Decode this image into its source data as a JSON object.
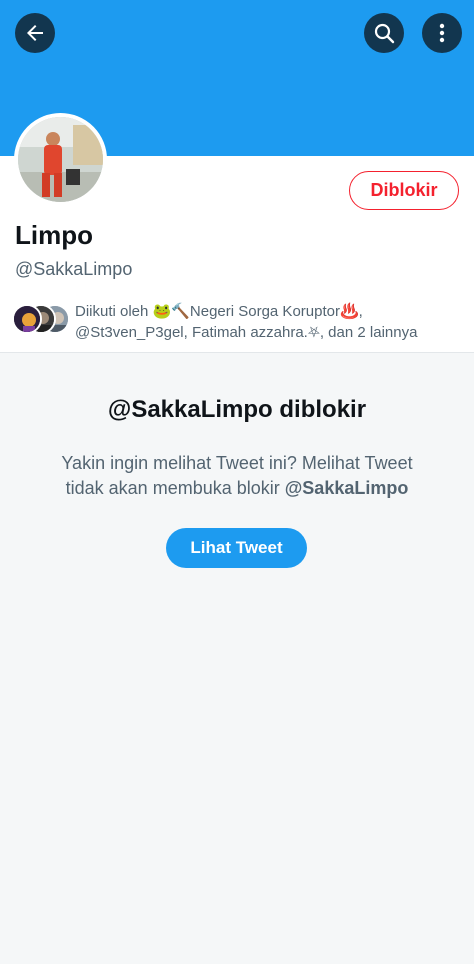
{
  "header": {
    "back_icon": "arrow-left-icon",
    "search_icon": "search-icon",
    "more_icon": "more-vertical-icon"
  },
  "profile": {
    "display_name": "Limpo",
    "handle": "@SakkaLimpo",
    "block_button_label": "Diblokir",
    "followers_text_line1": "Diikuti oleh 🐸🔨Negeri Sorga Koruptor♨️,",
    "followers_text_line2": "@St3ven_P3gel, Fatimah azzahra.⛧, dan 2 lainnya"
  },
  "blocked_notice": {
    "title": "@SakkaLimpo diblokir",
    "description_prefix": "Yakin ingin melihat Tweet ini? Melihat Tweet tidak akan membuka blokir ",
    "description_handle": "@SakkaLimpo",
    "view_button_label": "Lihat Tweet"
  },
  "colors": {
    "banner": "#1d9bf0",
    "block_red": "#f4212e",
    "accent_blue": "#1d9bf0"
  }
}
